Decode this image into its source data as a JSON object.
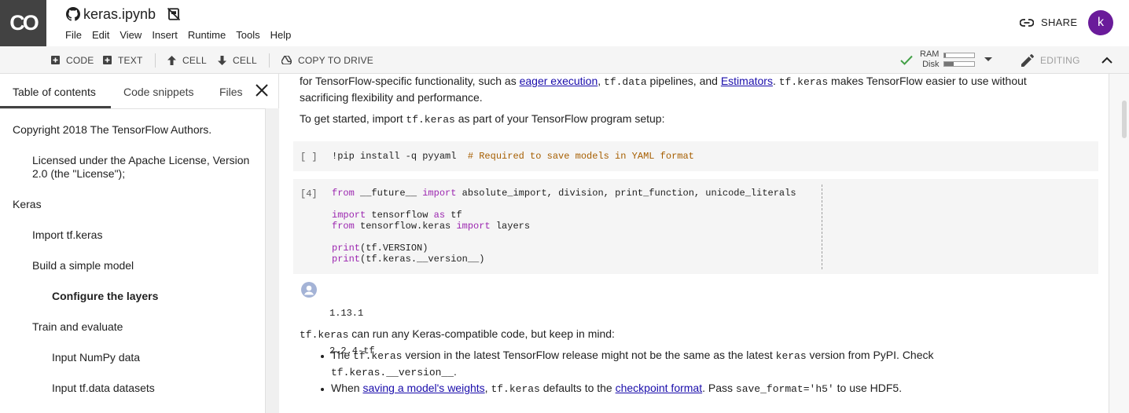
{
  "app": {
    "logo": "CO",
    "notebook_title": "keras.ipynb",
    "menu": [
      "File",
      "Edit",
      "View",
      "Insert",
      "Runtime",
      "Tools",
      "Help"
    ],
    "share_label": "SHARE",
    "avatar_letter": "k"
  },
  "toolbar": {
    "code_label": "CODE",
    "text_label": "TEXT",
    "cell_up_label": "CELL",
    "cell_down_label": "CELL",
    "copy_label": "COPY TO DRIVE",
    "ram_label": "RAM",
    "disk_label": "Disk",
    "ram_fill": 0.05,
    "disk_fill": 0.3,
    "editing_label": "EDITING"
  },
  "sidebar": {
    "tabs": [
      "Table of contents",
      "Code snippets",
      "Files"
    ],
    "toc": [
      {
        "label": "Copyright 2018 The TensorFlow Authors.",
        "level": 0
      },
      {
        "label": "Licensed under the Apache License, Version",
        "label2": "2.0 (the \"License\");",
        "level": 1
      },
      {
        "label": "Keras",
        "level": 0
      },
      {
        "label": "Import tf.keras",
        "level": 1
      },
      {
        "label": "Build a simple model",
        "level": 1
      },
      {
        "label": "Configure the layers",
        "level": 2,
        "bold": true
      },
      {
        "label": "Train and evaluate",
        "level": 1
      },
      {
        "label": "Input NumPy data",
        "level": 2
      },
      {
        "label": "Input tf.data datasets",
        "level": 2
      }
    ]
  },
  "notebook": {
    "intro": {
      "p1_a": "for TensorFlow-specific functionality, such as ",
      "link_eager": "eager execution",
      "p1_b": ", ",
      "code_tfdata": "tf.data",
      "p1_c": " pipelines, and ",
      "link_estimators": "Estimators",
      "p1_d": ". ",
      "code_tfkeras": "tf.keras",
      "p1_e": " makes TensorFlow easier to use without",
      "p1_line2": "sacrificing flexibility and performance.",
      "p2_a": "To get started, import ",
      "p2_code": "tf.keras",
      "p2_b": " as part of your TensorFlow program setup:"
    },
    "cell1": {
      "prompt": "[ ]",
      "code": "!pip install -q pyyaml  ",
      "comment": "# Required to save models in YAML format"
    },
    "cell2": {
      "prompt": "[4]",
      "l1_kw1": "from",
      "l1_a": " __future__ ",
      "l1_kw2": "import",
      "l1_b": " absolute_import, division, print_function, unicode_literals",
      "l2_kw1": "import",
      "l2_a": " tensorflow ",
      "l2_kw2": "as",
      "l2_b": " tf",
      "l3_kw1": "from",
      "l3_a": " tensorflow.keras ",
      "l3_kw2": "import",
      "l3_b": " layers",
      "l4_kw": "print",
      "l4_a": "(tf.VERSION)",
      "l5_kw": "print",
      "l5_a": "(tf.keras.__version__)",
      "output": [
        "1.13.1",
        "2.2.4-tf"
      ]
    },
    "after": {
      "p3_code": "tf.keras",
      "p3_text": " can run any Keras-compatible code, but keep in mind:",
      "b1_a": "The ",
      "b1_code1": "tf.keras",
      "b1_b": " version in the latest TensorFlow release might not be the same as the latest ",
      "b1_code2": "keras",
      "b1_c": " version from PyPI. Check",
      "b1_code3": "tf.keras.__version__",
      "b1_d": ".",
      "b2_a": "When ",
      "b2_link1": "saving a model's weights",
      "b2_b": ", ",
      "b2_code1": "tf.keras",
      "b2_c": " defaults to the ",
      "b2_link2": "checkpoint format",
      "b2_d": ". Pass ",
      "b2_code2": "save_format='h5'",
      "b2_e": " to use HDF5."
    }
  },
  "colors": {
    "accent_avatar": "#6a1b9a",
    "keyword": "#9c27b0",
    "comment": "#a65e00",
    "link": "#1a0dab",
    "ok_check": "#43a047"
  },
  "icons": [
    "github-icon",
    "no-drive-icon",
    "link-icon",
    "plus-icon",
    "arrow-up-icon",
    "arrow-down-icon",
    "drive-icon",
    "check-icon",
    "caret-down-icon",
    "pencil-icon",
    "chevron-up-icon",
    "close-icon",
    "output-avatar-icon"
  ]
}
